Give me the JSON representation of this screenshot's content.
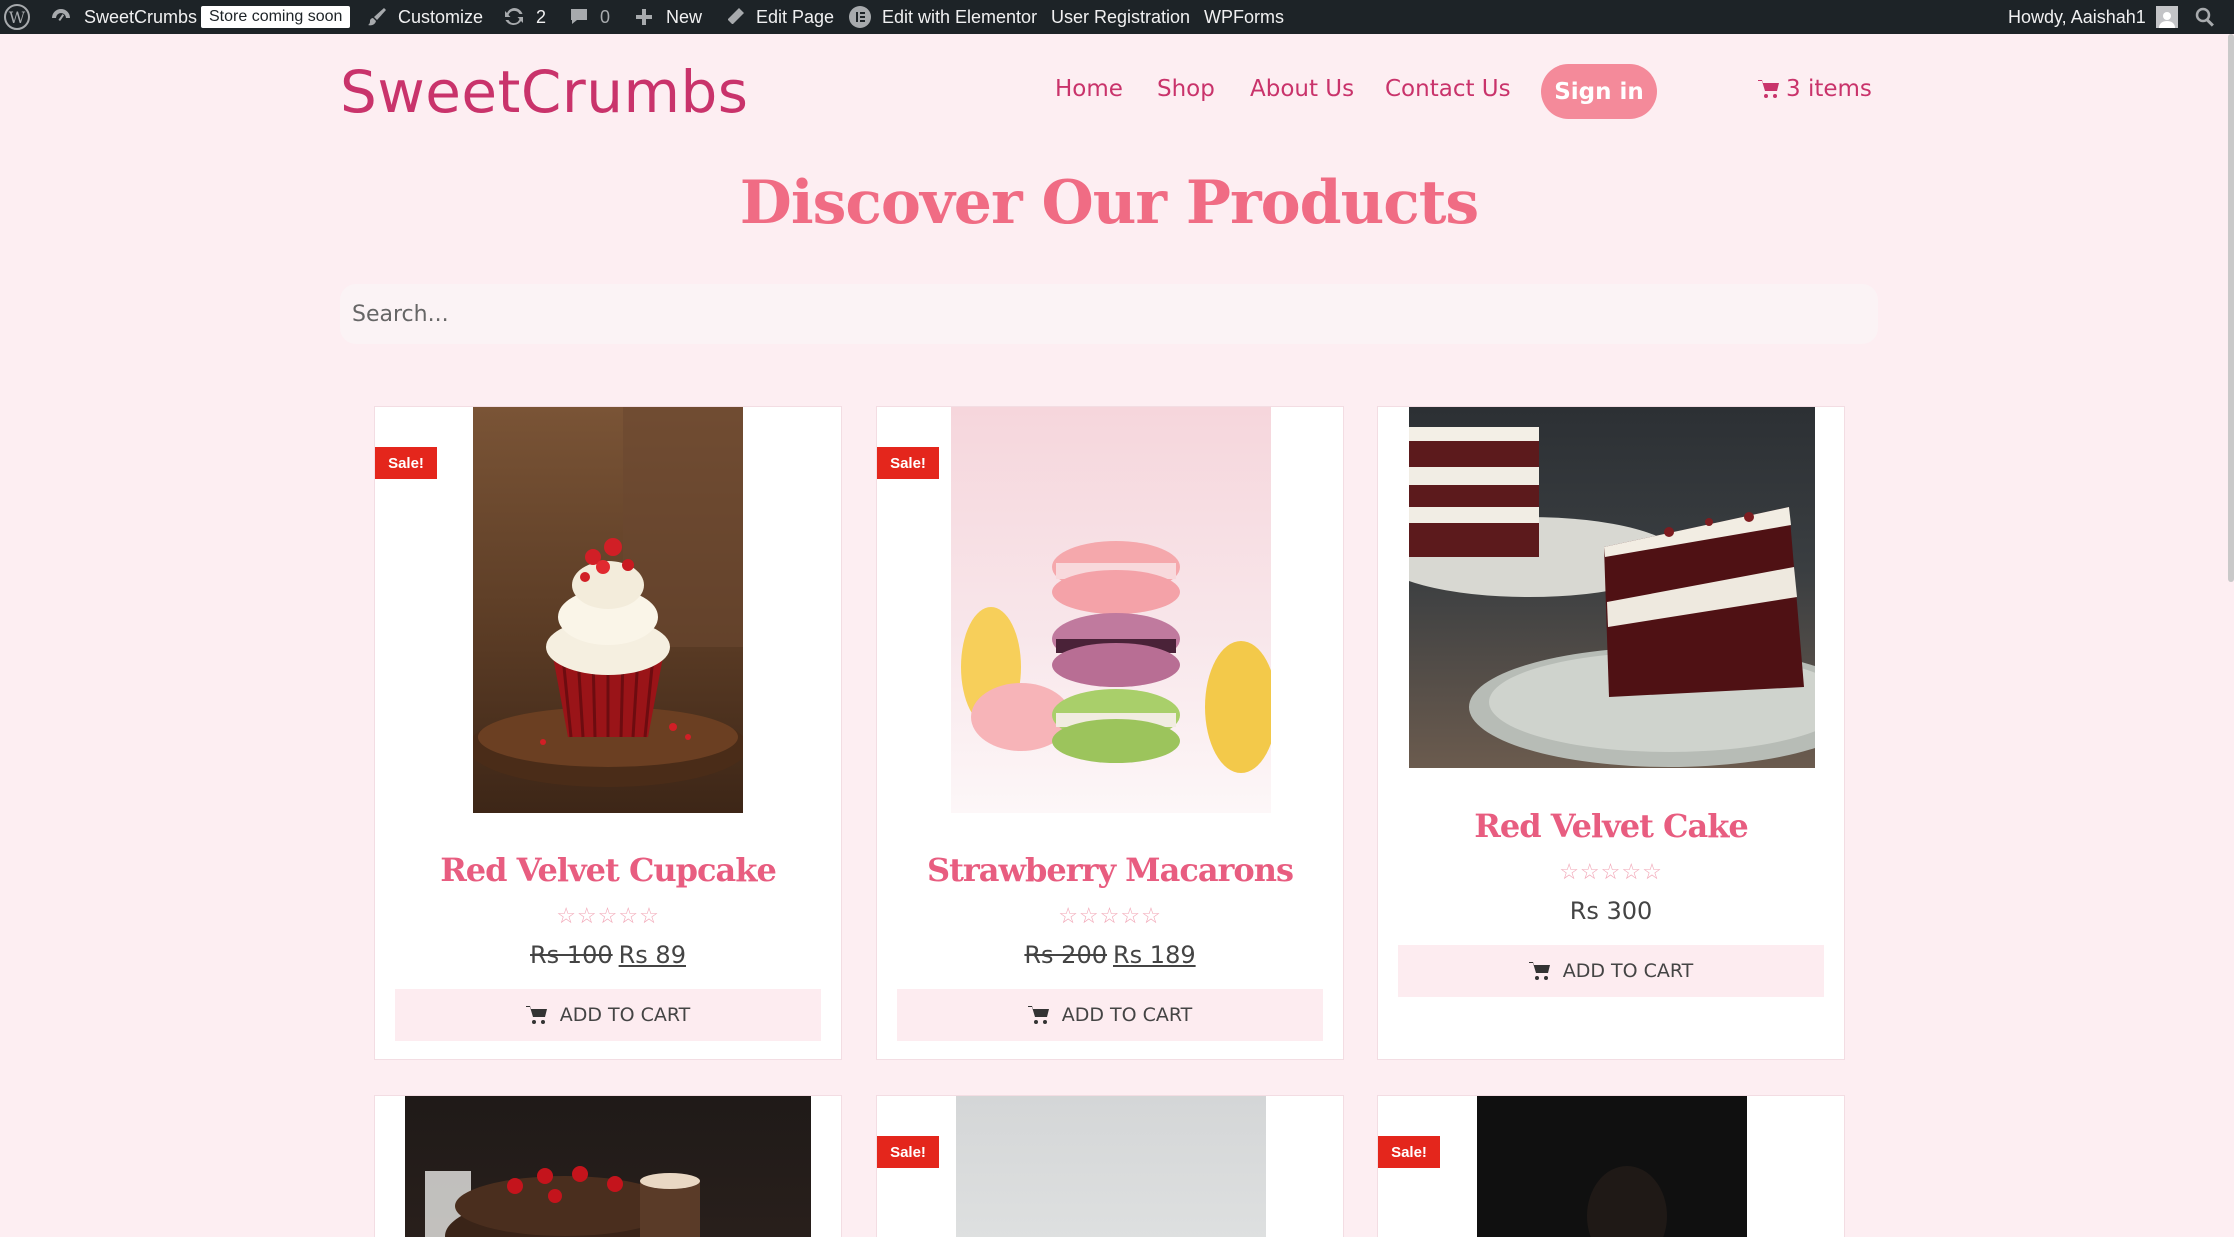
{
  "adminbar": {
    "site_name": "SweetCrumbs",
    "badge": "Store coming soon",
    "customize": "Customize",
    "updates_count": "2",
    "comments_count": "0",
    "new": "New",
    "edit_page": "Edit Page",
    "edit_elementor": "Edit with Elementor",
    "user_registration": "User Registration",
    "wpforms": "WPForms",
    "howdy": "Howdy, Aaishah1"
  },
  "header": {
    "logo": "SweetCrumbs",
    "nav": [
      "Home",
      "Shop",
      "About Us",
      "Contact Us"
    ],
    "signin": "Sign in",
    "cart": "3 items"
  },
  "page_title": "Discover Our Products",
  "search": {
    "placeholder": "Search..."
  },
  "products": [
    {
      "name": "Red Velvet Cupcake",
      "sale_badge": "Sale!",
      "old_price": "Rs 100",
      "price": "Rs 89",
      "stars": "☆☆☆☆☆",
      "button": "ADD TO CART"
    },
    {
      "name": "Strawberry Macarons",
      "sale_badge": "Sale!",
      "old_price": "Rs 200",
      "price": "Rs 189",
      "stars": "☆☆☆☆☆",
      "button": "ADD TO CART"
    },
    {
      "name": "Red Velvet Cake",
      "price": "Rs 300",
      "stars": "☆☆☆☆☆",
      "button": "ADD TO CART"
    },
    {
      "name": ""
    },
    {
      "sale_badge": "Sale!"
    },
    {
      "sale_badge": "Sale!"
    }
  ],
  "colors": {
    "accent": "#c9336b",
    "heading": "#f06c84",
    "sale": "#e4261c",
    "background": "#fdeef2"
  }
}
